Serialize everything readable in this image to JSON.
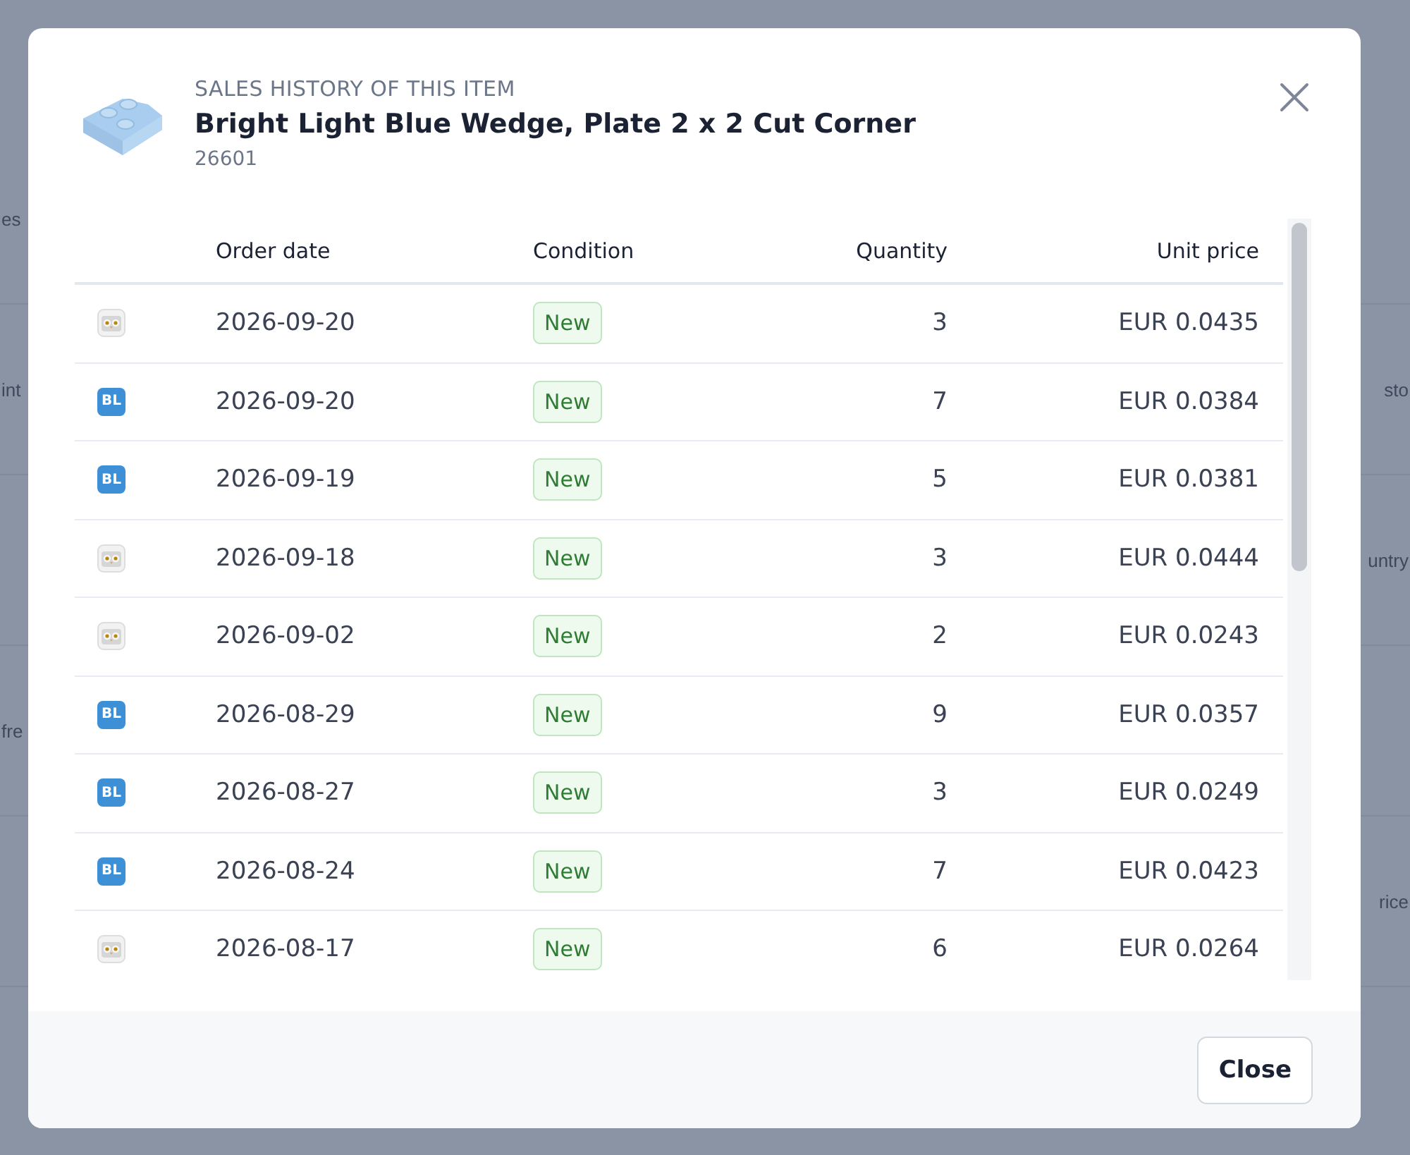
{
  "background": {
    "fragments": [
      {
        "left": "es"
      },
      {
        "left": "int",
        "right": "sto"
      },
      {
        "right": "untry"
      },
      {
        "left": "fre"
      },
      {
        "right": "rice"
      }
    ]
  },
  "dialog": {
    "eyebrow": "SALES HISTORY OF THIS ITEM",
    "title": "Bright Light Blue Wedge, Plate 2 x 2 Cut Corner",
    "item_number": "26601",
    "table": {
      "columns": [
        "Order date",
        "Condition",
        "Quantity",
        "Unit price"
      ],
      "rows": [
        {
          "source": {
            "kind": "owl"
          },
          "date": "2026-09-20",
          "condition": "New",
          "quantity": "3",
          "price": "EUR 0.0435"
        },
        {
          "source": {
            "kind": "bl",
            "label": "BL"
          },
          "date": "2026-09-20",
          "condition": "New",
          "quantity": "7",
          "price": "EUR 0.0384"
        },
        {
          "source": {
            "kind": "bl",
            "label": "BL"
          },
          "date": "2026-09-19",
          "condition": "New",
          "quantity": "5",
          "price": "EUR 0.0381"
        },
        {
          "source": {
            "kind": "owl"
          },
          "date": "2026-09-18",
          "condition": "New",
          "quantity": "3",
          "price": "EUR 0.0444"
        },
        {
          "source": {
            "kind": "owl"
          },
          "date": "2026-09-02",
          "condition": "New",
          "quantity": "2",
          "price": "EUR 0.0243"
        },
        {
          "source": {
            "kind": "bl",
            "label": "BL"
          },
          "date": "2026-08-29",
          "condition": "New",
          "quantity": "9",
          "price": "EUR 0.0357"
        },
        {
          "source": {
            "kind": "bl",
            "label": "BL"
          },
          "date": "2026-08-27",
          "condition": "New",
          "quantity": "3",
          "price": "EUR 0.0249"
        },
        {
          "source": {
            "kind": "bl",
            "label": "BL"
          },
          "date": "2026-08-24",
          "condition": "New",
          "quantity": "7",
          "price": "EUR 0.0423"
        },
        {
          "source": {
            "kind": "owl"
          },
          "date": "2026-08-17",
          "condition": "New",
          "quantity": "6",
          "price": "EUR 0.0264"
        }
      ]
    },
    "close_button": "Close"
  }
}
